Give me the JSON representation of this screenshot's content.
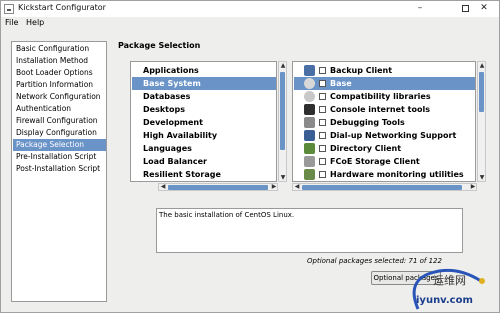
{
  "window": {
    "title": "Kickstart Configurator",
    "minimize": "–",
    "close": "✕"
  },
  "menu": [
    {
      "label": "File"
    },
    {
      "label": "Help"
    }
  ],
  "sidebar": {
    "items": [
      {
        "label": "Basic Configuration"
      },
      {
        "label": "Installation Method"
      },
      {
        "label": "Boot Loader Options"
      },
      {
        "label": "Partition Information"
      },
      {
        "label": "Network Configuration"
      },
      {
        "label": "Authentication"
      },
      {
        "label": "Firewall Configuration"
      },
      {
        "label": "Display Configuration"
      },
      {
        "label": "Package Selection",
        "selected": true
      },
      {
        "label": "Pre-Installation Script"
      },
      {
        "label": "Post-Installation Script"
      }
    ]
  },
  "main": {
    "section_title": "Package Selection",
    "groups": [
      {
        "label": "Applications"
      },
      {
        "label": "Base System",
        "selected": true
      },
      {
        "label": "Databases"
      },
      {
        "label": "Desktops"
      },
      {
        "label": "Development"
      },
      {
        "label": "High Availability"
      },
      {
        "label": "Languages"
      },
      {
        "label": "Load Balancer"
      },
      {
        "label": "Resilient Storage"
      }
    ],
    "packages": [
      {
        "label": "Backup Client",
        "icon": "backup-icon",
        "color": "#4a6fa5",
        "checked": false
      },
      {
        "label": "Base",
        "icon": "base-icon",
        "color": "#d8d8d8",
        "checked": false,
        "selected": true
      },
      {
        "label": "Compatibility libraries",
        "icon": "compat-libs-icon",
        "color": "#c8c8c8",
        "checked": false
      },
      {
        "label": "Console internet tools",
        "icon": "console-icon",
        "color": "#2e2e2e",
        "checked": false
      },
      {
        "label": "Debugging Tools",
        "icon": "debug-tools-icon",
        "color": "#8a8a8a",
        "checked": false
      },
      {
        "label": "Dial-up Networking Support",
        "icon": "dialup-icon",
        "color": "#3b5f94",
        "checked": false
      },
      {
        "label": "Directory Client",
        "icon": "directory-icon",
        "color": "#5a8a3a",
        "checked": false
      },
      {
        "label": "FCoE Storage Client",
        "icon": "fcoe-icon",
        "color": "#9a9a9a",
        "checked": false
      },
      {
        "label": "Hardware monitoring utilities",
        "icon": "hw-monitor-icon",
        "color": "#6a8a4a",
        "checked": false
      }
    ],
    "description": "The basic installation of CentOS Linux.",
    "selected_count": "Optional packages selected: 71 of 122",
    "optional_button": "Optional packages"
  },
  "watermark": {
    "line1": "运维网",
    "line2": "iyunv.com"
  },
  "colors": {
    "selection": "#6a93c8",
    "window_bg": "#eeeeec"
  }
}
